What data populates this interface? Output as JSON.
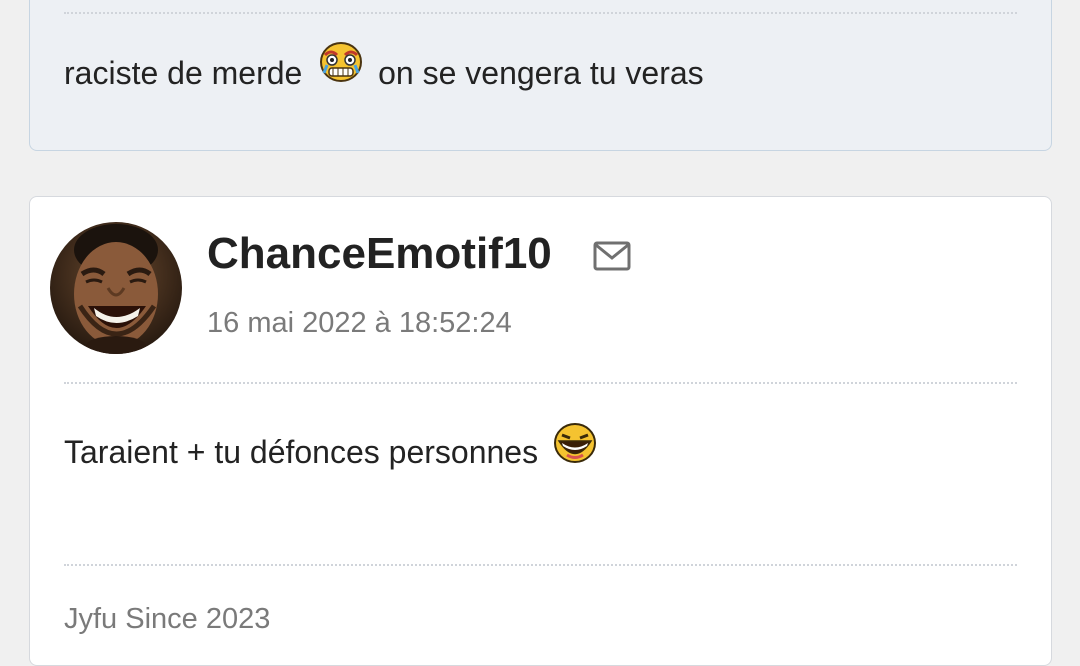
{
  "previous_post": {
    "message_before": "raciste de merde",
    "smiley_1": "angry-crying-smiley-icon",
    "message_after": "on se vengera tu veras"
  },
  "post": {
    "avatar": "user-avatar",
    "author": "ChanceEmotif10",
    "mail_icon": "mail-icon",
    "date": "16 mai 2022 à 18:52:24",
    "message": "Taraient + tu défonces personnes",
    "smiley": "laughing-smiley-icon",
    "signature": "Jyfu Since 2023"
  },
  "colors": {
    "page_bg": "#f0f0f0",
    "quote_bg": "#edf0f4",
    "quote_border": "#c7d5e2",
    "post_bg": "#ffffff",
    "muted_text": "#7a7a7a"
  }
}
